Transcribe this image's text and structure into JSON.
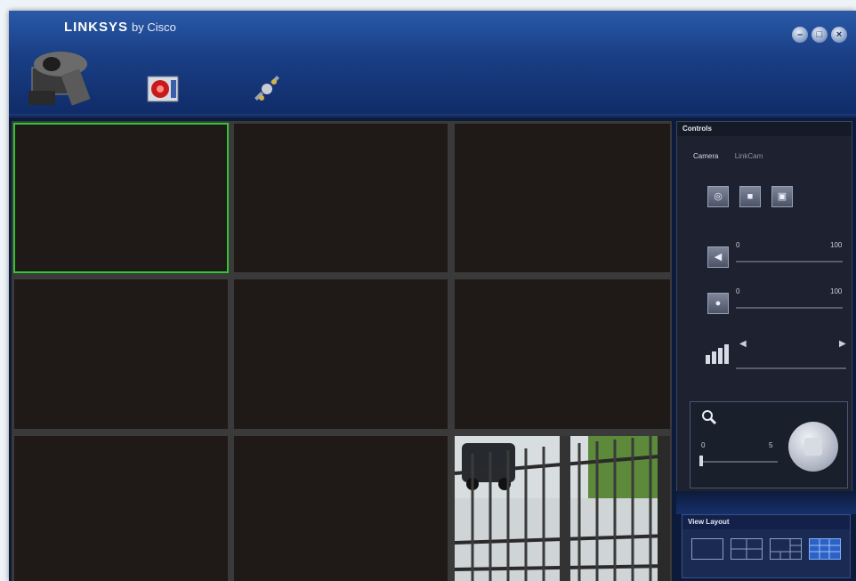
{
  "app": {
    "brand": "LINKSYS",
    "brand_sub": "by Cisco",
    "window_buttons": [
      "–",
      "□",
      "×"
    ]
  },
  "toolbar": {
    "tools": [
      {
        "name": "camera-tool",
        "icon": "security-camera-icon"
      },
      {
        "name": "recording-tool",
        "icon": "record-film-icon"
      },
      {
        "name": "settings-tool",
        "icon": "satellite-settings-icon"
      }
    ]
  },
  "view_grid": {
    "rows": 3,
    "cols": 3,
    "active_cell": 0,
    "feed_cell": 8
  },
  "controls": {
    "header": "Controls",
    "camera_label": "Camera",
    "camera_value": "LinkCam",
    "action_icons": [
      "snapshot-icon",
      "record-icon",
      "camera-icon"
    ],
    "volume": {
      "min": "0",
      "max": "100"
    },
    "mic": {
      "min": "0",
      "max": "100"
    },
    "quality": {
      "left": "◀",
      "right": "▶"
    },
    "zoom": {
      "min": "0",
      "max": "5",
      "value": 0
    }
  },
  "view_layout": {
    "header": "View Layout",
    "options": [
      "1x1",
      "2x2",
      "1+5",
      "3x3"
    ],
    "selected": "3x3"
  },
  "colors": {
    "active_cell": "#32c432",
    "titlebar": "#1a3f86",
    "cell_bg": "#1f1a17"
  }
}
